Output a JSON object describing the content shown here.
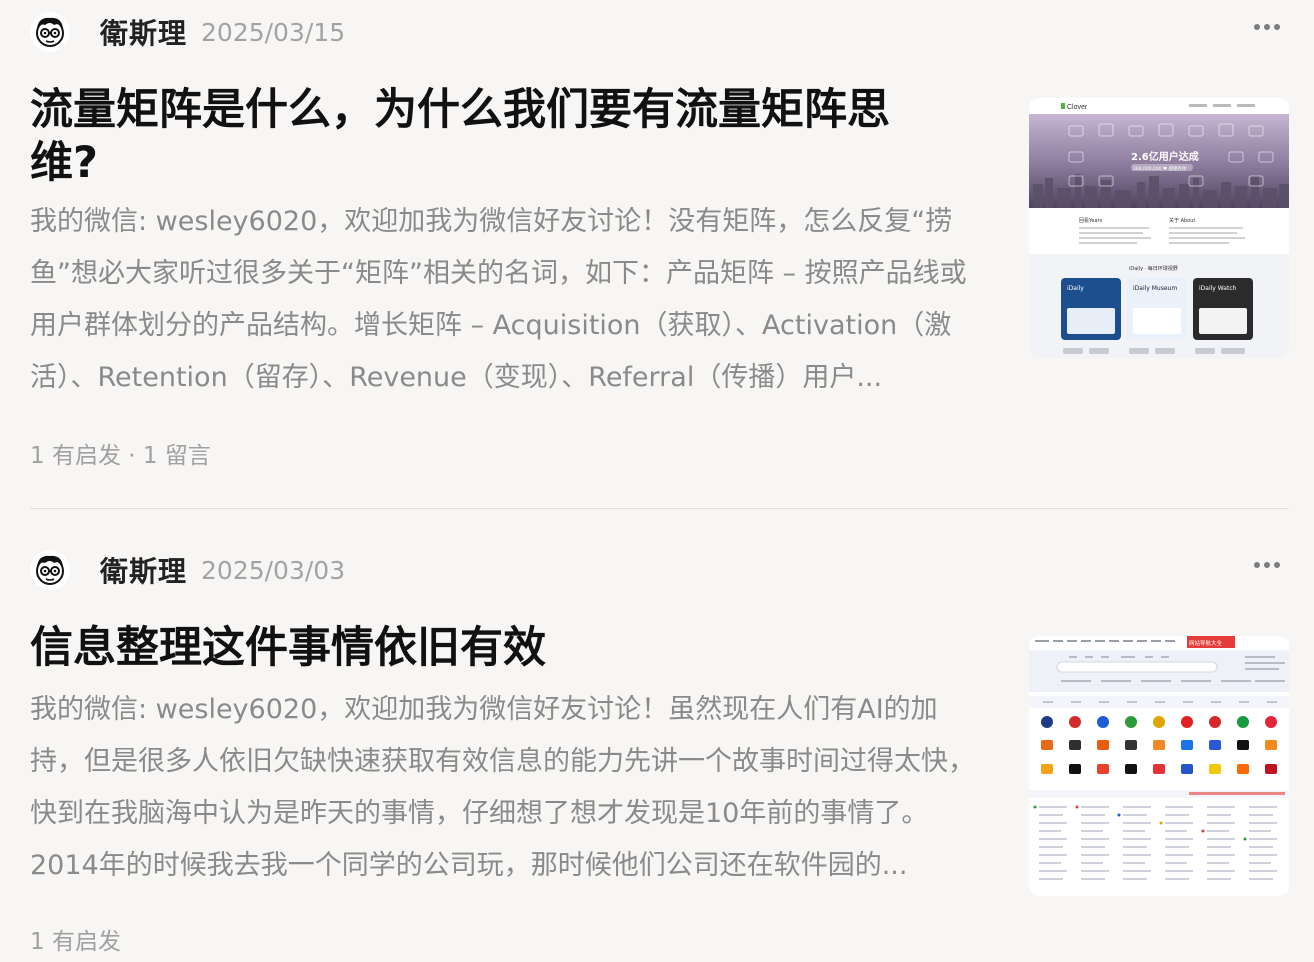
{
  "posts": [
    {
      "author": "衛斯理",
      "date": "2025/03/15",
      "title": "流量矩阵是什么，为什么我们要有流量矩阵思维?",
      "excerpt": "我的微信: wesley6020，欢迎加我为微信好友讨论！没有矩阵，怎么反复“捞鱼”想必大家听过很多关于“矩阵”相关的名词，如下：产品矩阵 – 按照产品线或用户群体划分的产品结构。增长矩阵 – Acquisition（获取）、Activation（激活）、Retention（留存）、Revenue（变现）、Referral（传播）用户...",
      "stats": "1 有启发 · 1 留言",
      "thumbnail": {
        "brand": "Clover",
        "headline": "2.6亿用户达成",
        "subline": "260,000,000 ♥ 感谢有你",
        "section_a": "回看Years",
        "section_b": "关于 About",
        "card_heading": "iDaily · 每日环球视野",
        "card_1": "iDaily",
        "card_2": "iDaily Museum",
        "card_3": "iDaily Watch"
      }
    },
    {
      "author": "衛斯理",
      "date": "2025/03/03",
      "title": "信息整理这件事情依旧有效",
      "excerpt": "我的微信: wesley6020，欢迎加我为微信好友讨论！虽然现在人们有AI的加持，但是很多人依旧欠缺快速获取有效信息的能力先讲一个故事时间过得太快，快到在我脑海中认为是昨天的事情，仔细想了想才发现是10年前的事情了。2014年的时候我去我一个同学的公司玩，那时候他们公司还在软件园的...",
      "stats": "1 有启发",
      "thumbnail": {
        "badge": "网站导航大全"
      }
    }
  ],
  "icons": {
    "avatar": "cartoon-face-with-glasses-icon",
    "more": "more-dots-icon"
  },
  "colors": {
    "background": "#f7f6f4",
    "title": "#111111",
    "excerpt": "#8a8a8a",
    "meta": "#a3a3a3"
  }
}
